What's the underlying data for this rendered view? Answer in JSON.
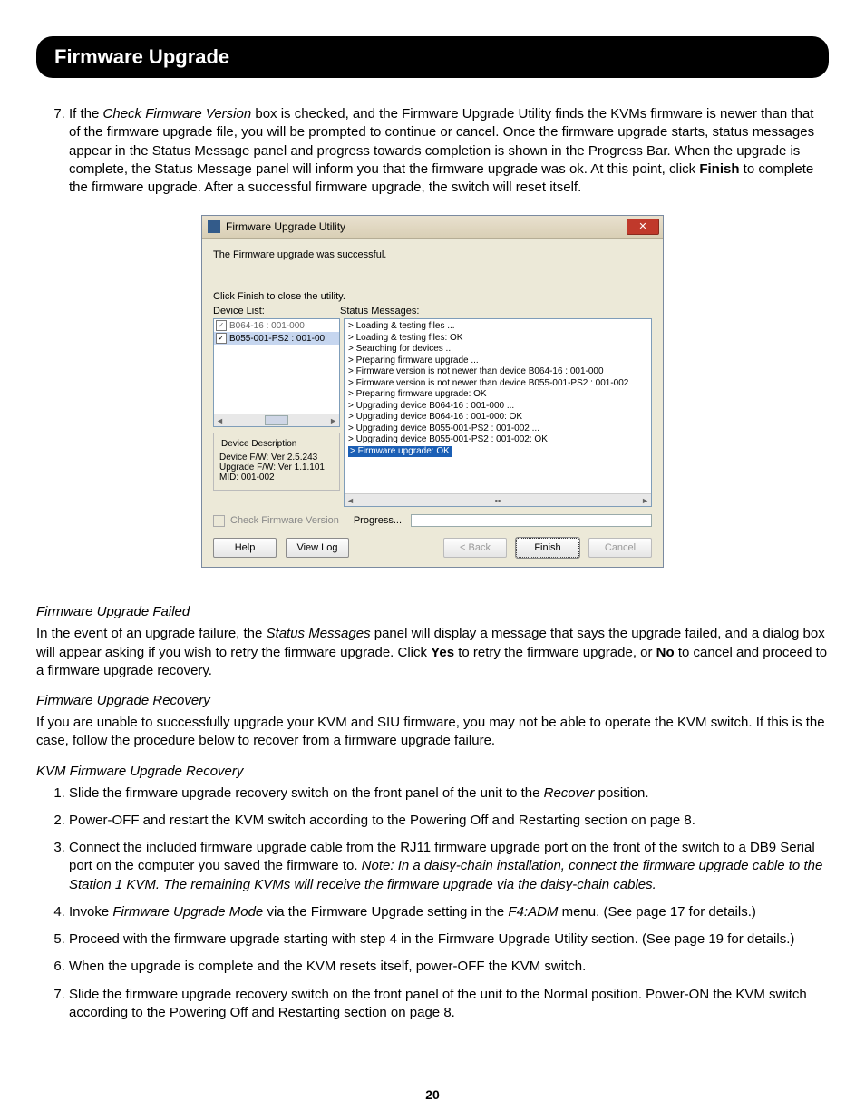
{
  "header": {
    "title": "Firmware Upgrade"
  },
  "step7": {
    "number": "7.",
    "text_a": "If the ",
    "em_a": "Check Firmware Version",
    "text_b": " box is checked, and the Firmware Upgrade Utility finds the KVMs firmware is newer than that of the firmware upgrade file, you will be prompted to continue or cancel. Once the firmware upgrade starts, status messages appear in the Status Message panel and progress towards completion is shown in the Progress Bar. When the upgrade is complete, the Status Message panel will inform you that the firmware upgrade was ok. At this point, click ",
    "bold_a": "Finish",
    "text_c": " to complete the firmware upgrade. After a successful firmware upgrade, the switch will reset itself."
  },
  "dialog": {
    "title": "Firmware Upgrade Utility",
    "success": "The Firmware upgrade was successful.",
    "instruct": "Click Finish to close the utility.",
    "device_list_label": "Device List:",
    "status_label": "Status Messages:",
    "devices": [
      {
        "name": "B064-16 : 001-000",
        "selected": false
      },
      {
        "name": "B055-001-PS2 : 001-00",
        "selected": true
      }
    ],
    "desc": {
      "legend": "Device Description",
      "l1": "Device F/W: Ver 2.5.243",
      "l2": "Upgrade F/W: Ver 1.1.101",
      "l3": "MID: 001-002"
    },
    "status_lines": [
      "> Loading & testing files ...",
      "> Loading & testing files: OK",
      "> Searching for devices ...",
      "> Preparing firmware upgrade ...",
      "> Firmware version is not newer than device B064-16 : 001-000",
      "> Firmware version is not newer than device B055-001-PS2 : 001-002",
      "> Preparing firmware upgrade: OK",
      "> Upgrading device B064-16 : 001-000 ...",
      "> Upgrading device B064-16 : 001-000: OK",
      "> Upgrading device B055-001-PS2 : 001-002 ...",
      "> Upgrading device B055-001-PS2 : 001-002: OK"
    ],
    "status_highlight": "> Firmware upgrade: OK",
    "check_label": "Check Firmware Version",
    "progress_label": "Progress...",
    "buttons": {
      "help": "Help",
      "viewlog": "View Log",
      "back": "< Back",
      "finish": "Finish",
      "cancel": "Cancel"
    }
  },
  "failed": {
    "heading": "Firmware Upgrade Failed",
    "text_a": "In the event of an upgrade failure, the ",
    "em_a": "Status Messages",
    "text_b": " panel will display a message that says the upgrade failed, and a dialog box will appear asking if you wish to retry the firmware upgrade. Click ",
    "bold_yes": "Yes",
    "text_c": " to retry the firmware upgrade, or ",
    "bold_no": "No",
    "text_d": " to cancel and proceed to a firmware upgrade recovery."
  },
  "recovery": {
    "heading": "Firmware Upgrade Recovery",
    "text": "If you are unable to successfully upgrade your KVM and SIU firmware, you may not be able to operate the KVM switch. If this is the case, follow the procedure below to recover from a firmware upgrade failure."
  },
  "kvm": {
    "heading": "KVM Firmware Upgrade Recovery",
    "steps": {
      "s1a": "Slide the firmware upgrade recovery switch on the front panel of the unit to the ",
      "s1em": "Recover",
      "s1b": " position.",
      "s2": "Power-OFF and restart the KVM switch according to the Powering Off and Restarting section on page 8.",
      "s3a": "Connect the included firmware upgrade cable from the RJ11 firmware upgrade port on the front of the switch to a DB9 Serial port on the computer you saved the firmware to. ",
      "s3em": "Note: In a daisy-chain installation, connect the firmware upgrade cable to the Station 1 KVM. The remaining KVMs will receive the firmware upgrade via the daisy-chain cables.",
      "s4a": "Invoke ",
      "s4em1": "Firmware Upgrade Mode",
      "s4b": " via the Firmware Upgrade setting in the ",
      "s4em2": "F4:ADM",
      "s4c": " menu. (See page 17 for details.)",
      "s5": "Proceed with the firmware upgrade starting with step 4 in the Firmware Upgrade Utility section. (See page 19 for details.)",
      "s6": "When the upgrade is complete and the KVM resets itself, power-OFF the KVM switch.",
      "s7": "Slide the firmware upgrade recovery switch on the front panel of the unit to the Normal position. Power-ON the KVM switch according to the Powering Off and Restarting section on page 8."
    }
  },
  "pagenum": "20"
}
